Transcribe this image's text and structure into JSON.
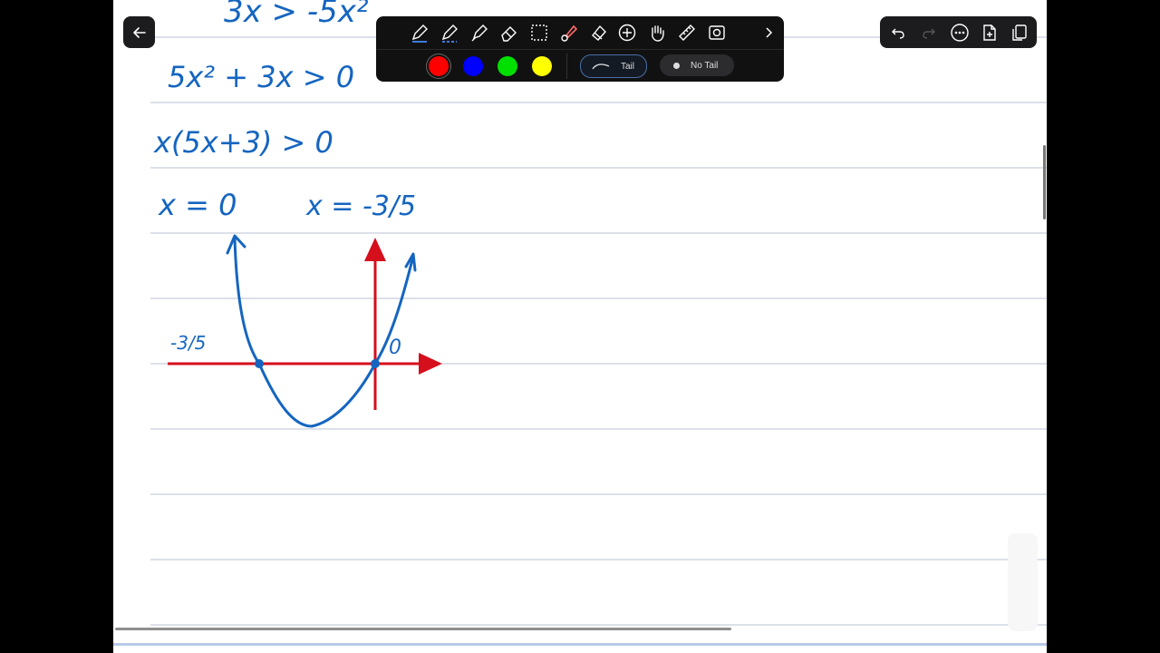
{
  "navigation": {
    "back_icon": "back-arrow-icon"
  },
  "toolbar": {
    "tools": [
      "pen-icon",
      "pencil-icon",
      "highlighter-icon",
      "eraser-icon",
      "lasso-select-icon",
      "laser-pointer-icon",
      "shapes-icon",
      "add-icon",
      "hand-draw-icon",
      "ruler-icon",
      "image-icon",
      "chevron-right-icon"
    ],
    "colors": [
      "#ff0000",
      "#0000ff",
      "#00e000",
      "#ffff00"
    ],
    "selected_color": "#ff0000",
    "tail_label": "Tail",
    "no_tail_label": "No Tail"
  },
  "actions": [
    "undo-icon",
    "redo-icon",
    "more-icon",
    "add-page-icon",
    "pages-icon"
  ],
  "ink_colors": {
    "math": "#1565c0",
    "axes": "#d50f1c"
  },
  "handwriting": {
    "line1": "3x > -5x²",
    "line2": "5x² + 3x > 0",
    "line3": "x(5x+3) > 0",
    "root1": "x = 0",
    "root2": "x = -3/5",
    "label_neg": "-3/5",
    "label_zero": "0"
  }
}
